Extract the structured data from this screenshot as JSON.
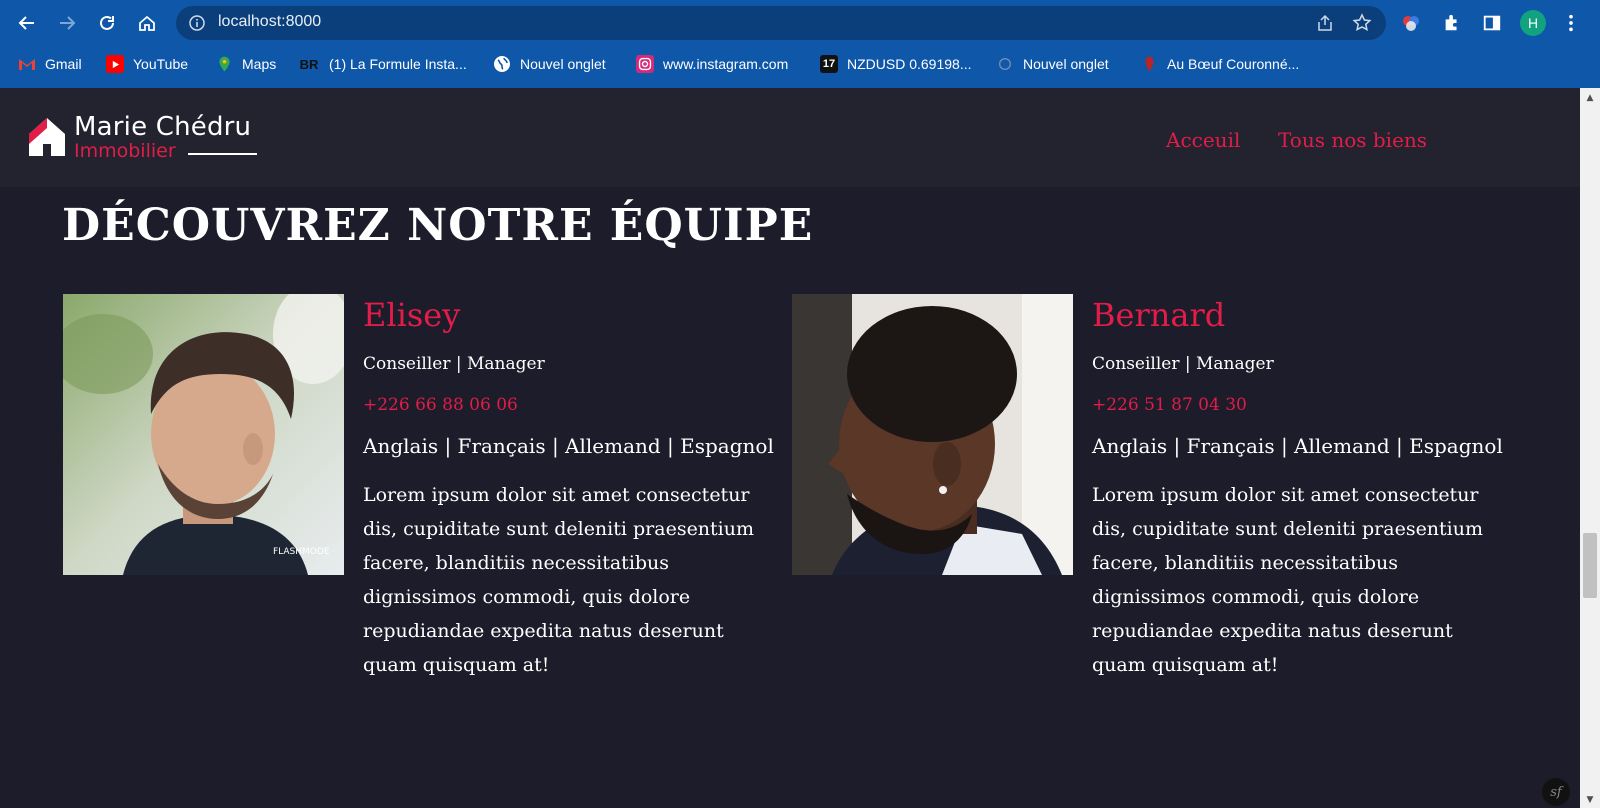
{
  "browser": {
    "url": "localhost:8000",
    "profile_initial": "H",
    "bookmarks": [
      {
        "label": "Gmail",
        "icon": "gmail-icon"
      },
      {
        "label": "YouTube",
        "icon": "youtube-icon"
      },
      {
        "label": "Maps",
        "icon": "maps-icon"
      },
      {
        "label": "(1) La Formule Insta...",
        "icon": "br-icon",
        "icon_text": "BR"
      },
      {
        "label": "Nouvel onglet",
        "icon": "globe-icon"
      },
      {
        "label": "www.instagram.com",
        "icon": "instagram-icon"
      },
      {
        "label": "NZDUSD 0.69198...",
        "icon": "tradingview-icon",
        "icon_text": "17"
      },
      {
        "label": "Nouvel onglet",
        "icon": "page-icon"
      },
      {
        "label": "Au Bœuf Couronné...",
        "icon": "boeuf-icon"
      }
    ]
  },
  "header": {
    "logo_name": "Marie Chédru",
    "logo_sub": "Immobilier",
    "nav": [
      "Acceuil",
      "Tous nos biens"
    ]
  },
  "section": {
    "title": "DÉCOUVREZ NOTRE ÉQUIPE"
  },
  "agents": [
    {
      "name": "Elisey",
      "role": "Conseiller | Manager",
      "phone": "+226 66 88 06 06",
      "languages": "Anglais | Français | Allemand | Espagnol",
      "description": "Lorem ipsum dolor sit amet consectetur dis, cupiditate sunt deleniti praesentium facere, blanditiis necessitatibus dignissimos commodi, quis dolore repudiandae expedita natus deserunt quam quisquam at!",
      "photo_watermark": "FLASHMODE"
    },
    {
      "name": "Bernard",
      "role": "Conseiller | Manager",
      "phone": "+226 51 87 04 30",
      "languages": "Anglais | Français | Allemand | Espagnol",
      "description": "Lorem ipsum dolor sit amet consectetur dis, cupiditate sunt deleniti praesentium facere, blanditiis necessitatibus dignissimos commodi, quis dolore repudiandae expedita natus deserunt quam quisquam at!"
    }
  ],
  "colors": {
    "accent": "#e11d48",
    "page_bg": "#1d1c2a",
    "header_bg": "#23222f",
    "chrome_bg": "#0f57a8"
  }
}
